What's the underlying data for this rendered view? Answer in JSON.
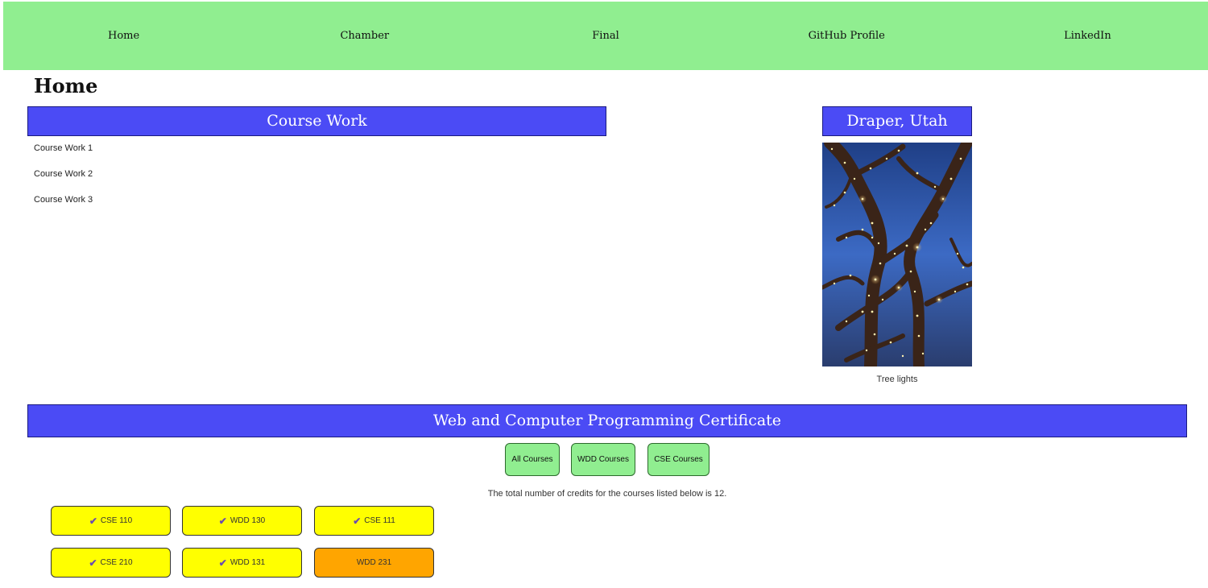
{
  "nav": {
    "items": [
      "Home",
      "Chamber",
      "Final",
      "GitHub Profile",
      "LinkedIn"
    ]
  },
  "page": {
    "title": "Home"
  },
  "coursework": {
    "heading": "Course Work",
    "items": [
      "Course Work 1",
      "Course Work 2",
      "Course Work 3"
    ]
  },
  "location": {
    "heading": "Draper, Utah",
    "image_caption": "Tree lights"
  },
  "certificate": {
    "heading": "Web and Computer Programming Certificate",
    "filters": [
      "All Courses",
      "WDD Courses",
      "CSE Courses"
    ],
    "credits_text": "The total number of credits for the courses listed below is 12.",
    "courses": [
      {
        "label": "CSE 110",
        "completed": true
      },
      {
        "label": "WDD 130",
        "completed": true
      },
      {
        "label": "CSE 111",
        "completed": true
      },
      {
        "label": "CSE 210",
        "completed": true
      },
      {
        "label": "WDD 131",
        "completed": true
      },
      {
        "label": "WDD 231",
        "completed": false
      }
    ]
  },
  "colors": {
    "nav_bg": "#90ee90",
    "heading_bg": "#4b4bf5",
    "completed_course": "#ffff00",
    "pending_course": "#ffa500",
    "filter_button": "#90ee90"
  },
  "icons": {
    "completed": "check-icon"
  }
}
